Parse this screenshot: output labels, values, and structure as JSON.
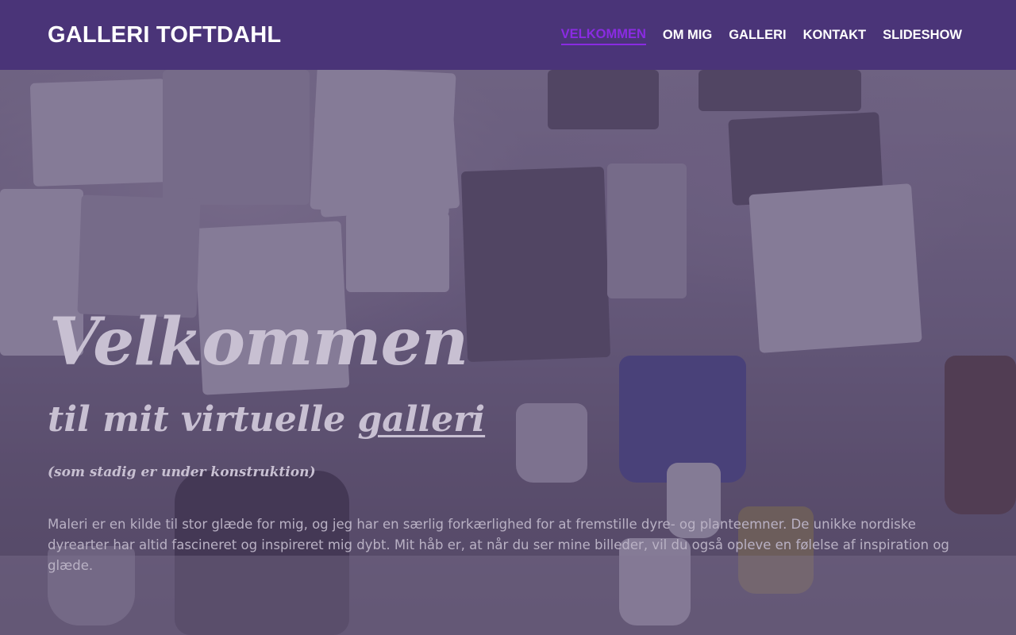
{
  "header": {
    "logo": "GALLERI TOFTDAHL",
    "nav": [
      {
        "label": "VELKOMMEN",
        "active": true
      },
      {
        "label": "OM MIG",
        "active": false
      },
      {
        "label": "GALLERI",
        "active": false
      },
      {
        "label": "KONTAKT",
        "active": false
      },
      {
        "label": "SLIDESHOW",
        "active": false
      }
    ]
  },
  "hero": {
    "title": "Velkommen",
    "subtitle_prefix": "til mit virtuelle ",
    "subtitle_link": "galleri",
    "note": "(som stadig er under konstruktion)",
    "text": "Maleri er en kilde til stor glæde for mig, og jeg har en særlig forkærlighed for at fremstille dyre- og planteemner. De unikke nordiske dyrearter har altid fascineret og inspireret mig dybt. Mit håb er, at når du ser mine billeder, vil du også opleve en følelse af inspiration og glæde."
  },
  "colors": {
    "header_bg": "#4a3478",
    "nav_active": "#8a2be2",
    "nav_text": "#ffffff",
    "hero_text": "#c8c0d2"
  }
}
